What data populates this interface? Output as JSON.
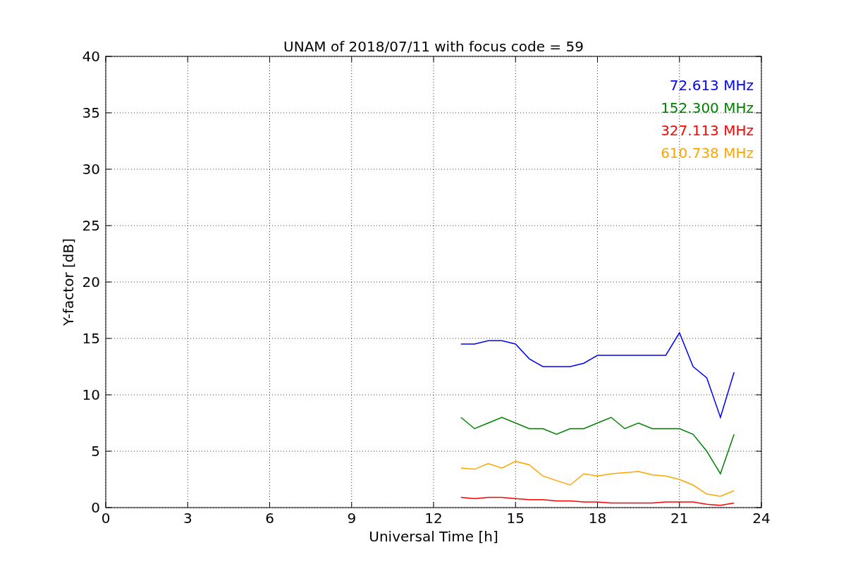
{
  "chart_data": {
    "type": "line",
    "title": "UNAM of 2018/07/11 with focus code = 59",
    "xlabel": "Universal Time [h]",
    "ylabel": "Y-factor [dB]",
    "x": [
      13,
      13.5,
      14,
      14.5,
      15,
      15.5,
      16,
      16.5,
      17,
      17.5,
      18,
      18.5,
      19,
      19.5,
      20,
      20.5,
      21,
      21.5,
      22,
      22.5,
      23
    ],
    "series": [
      {
        "name": "72.613 MHz",
        "color": "#0000ff",
        "values": [
          14.5,
          14.5,
          14.8,
          14.8,
          14.5,
          13.2,
          12.5,
          12.5,
          12.5,
          12.8,
          13.5,
          13.5,
          13.5,
          13.5,
          13.5,
          13.5,
          15.5,
          12.5,
          11.5,
          8,
          12
        ]
      },
      {
        "name": "152.300 MHz",
        "color": "#008000",
        "values": [
          8,
          7,
          7.5,
          8,
          7.5,
          7,
          7,
          6.5,
          7,
          7,
          7.5,
          8,
          7,
          7.5,
          7,
          7,
          7,
          6.5,
          5,
          3,
          6.5
        ]
      },
      {
        "name": "327.113 MHz",
        "color": "#ff0000",
        "values": [
          0.9,
          0.8,
          0.9,
          0.9,
          0.8,
          0.7,
          0.7,
          0.6,
          0.6,
          0.5,
          0.5,
          0.4,
          0.4,
          0.4,
          0.4,
          0.5,
          0.5,
          0.5,
          0.3,
          0.2,
          0.4
        ]
      },
      {
        "name": "610.738 MHz",
        "color": "#ffa500",
        "values": [
          3.5,
          3.4,
          3.9,
          3.5,
          4.1,
          3.8,
          2.8,
          2.4,
          2,
          3,
          2.8,
          3,
          3.1,
          3.2,
          2.9,
          2.8,
          2.5,
          2,
          1.2,
          1,
          1.5
        ]
      }
    ],
    "grid": true,
    "xlim": [
      0,
      24
    ],
    "ylim": [
      0,
      40
    ],
    "xticks": [
      0,
      3,
      6,
      9,
      12,
      15,
      18,
      21,
      24
    ],
    "yticks": [
      0,
      5,
      10,
      15,
      20,
      25,
      30,
      35,
      40
    ]
  }
}
